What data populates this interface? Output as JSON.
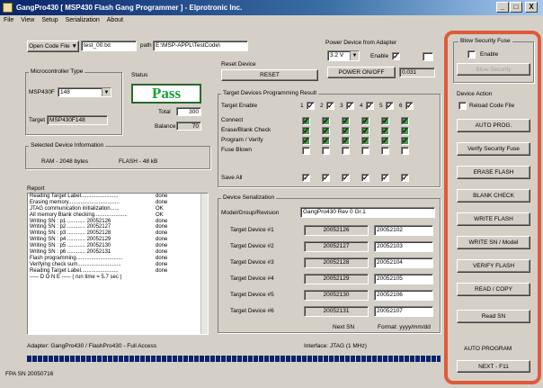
{
  "window": {
    "title": "GangPro430  [ MSP430 Flash Gang Programmer ]  -  Elprotronic Inc.",
    "min": "_",
    "max": "□",
    "close": "X"
  },
  "menu": [
    "File",
    "View",
    "Setup",
    "Serialization",
    "About"
  ],
  "code_file": {
    "button": "Open Code File",
    "filename": "test_00.txt",
    "path_label": "path",
    "path": "E:\\MSP-APPL\\TestCode\\"
  },
  "mcu": {
    "group": "Microcontroller Type",
    "family": "MSP430F",
    "model": "148",
    "target_label": "Target",
    "target_value": "MSP430F148"
  },
  "status": {
    "group": "Status",
    "result": "Pass",
    "total_label": "Total",
    "total_value": "300",
    "balance_label": "Balance",
    "balance_value": "70"
  },
  "device_info": {
    "group": "Selected Device Information",
    "ram": "RAM - 2048 bytes",
    "flash": "FLASH - 48 kB"
  },
  "power": {
    "group": "Power Device from Adapter",
    "voltage": "3.2 V",
    "enable_label": "Enable",
    "power_button": "POWER ON/OFF",
    "value": "0.031"
  },
  "reset": {
    "group": "Reset Device",
    "button": "RESET"
  },
  "targets_result": {
    "group": "Target Devices Programming Result",
    "enable_label": "Target Enable",
    "columns": [
      "1",
      "2",
      "3",
      "4",
      "5",
      "6"
    ],
    "rows": [
      "Connect",
      "Erase/Blank Check",
      "Program / Verify",
      "Fuse Blown"
    ],
    "save_all": "Save All"
  },
  "report": {
    "group": "Report",
    "lines": [
      {
        "text": "Reading Target Label.........................",
        "status": "done"
      },
      {
        "text": "Erasing memory..................................",
        "status": "done"
      },
      {
        "text": "JTAG communication initialization......",
        "status": "OK"
      },
      {
        "text": "All memory Blank checking......................",
        "status": "OK"
      },
      {
        "text": "    Writing SN : p1 ............ 20052126",
        "status": "done"
      },
      {
        "text": "    Writing SN : p2 ............ 20052127",
        "status": "done"
      },
      {
        "text": "    Writing SN : p3 ............ 20052128",
        "status": "done"
      },
      {
        "text": "    Writing SN : p4 ............ 20052129",
        "status": "done"
      },
      {
        "text": "    Writing SN : p5 ............ 20052130",
        "status": "done"
      },
      {
        "text": "    Writing SN : p6 ............ 20052131",
        "status": "done"
      },
      {
        "text": "Flash programming...............................",
        "status": "done"
      },
      {
        "text": "Verifying check sum.............................",
        "status": "done"
      },
      {
        "text": "Reading Target Label.........................",
        "status": "done"
      },
      {
        "text": "----- D O N E ----- ( run time =   5.7 sec )",
        "status": ""
      }
    ]
  },
  "serialization": {
    "group": "Device Serialization",
    "model_label": "Model/Group/Revision",
    "model_value": "GangPro430 Rev 0 Gr.1",
    "devices": [
      {
        "label": "Target Device #1",
        "sn": "20052126",
        "date": "20052102"
      },
      {
        "label": "Target Device #2",
        "sn": "20052127",
        "date": "20052103"
      },
      {
        "label": "Target Device #3",
        "sn": "20052128",
        "date": "20052104"
      },
      {
        "label": "Target Device #4",
        "sn": "20052129",
        "date": "20052105"
      },
      {
        "label": "Target Device #5",
        "sn": "20052130",
        "date": "20052106"
      },
      {
        "label": "Target Device #6",
        "sn": "20052131",
        "date": "20052107"
      }
    ],
    "next_label": "Next SN",
    "format_label": "Format: yyyy/mm/dd"
  },
  "adapter": {
    "text": "Adapter:  GangPro430 / FlashPro430 - Full Access",
    "interface": "Interface:   JTAG (1 MHz)"
  },
  "status_bar": {
    "text": "FPA SN 20050716"
  },
  "right_panel": {
    "security_group": "Blow Security Fuse",
    "security_enable": "Enable",
    "security_button": "Blow Security",
    "device_action": "Device Action",
    "reload_label": "Reload Code File",
    "buttons": [
      "AUTO PROG.",
      "Verify Security Fuse",
      "ERASE FLASH",
      "BLANK CHECK",
      "WRITE FLASH",
      "WRITE SN / Model",
      "VERIFY FLASH",
      "READ / COPY",
      "Read SN"
    ],
    "auto_program": "AUTO PROGRAM",
    "next_button": "NEXT - F11"
  },
  "colors": {
    "highlight": "#e05a3a",
    "pass": "#19a23a",
    "check_green": "#4a9a4a",
    "titlebar": "#0a246a"
  }
}
